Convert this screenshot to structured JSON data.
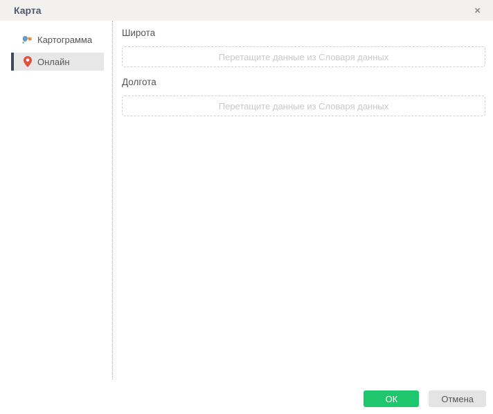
{
  "window": {
    "title": "Карта",
    "close_icon": "×"
  },
  "sidebar": {
    "items": [
      {
        "label": "Картограмма",
        "icon": "cartogram-map-icon",
        "selected": false
      },
      {
        "label": "Онлайн",
        "icon": "location-pin-icon",
        "selected": true
      }
    ]
  },
  "form": {
    "fields": [
      {
        "label": "Широта",
        "dropzone_placeholder": "Перетащите данные из Словаря данных"
      },
      {
        "label": "Долгота",
        "dropzone_placeholder": "Перетащите данные из Словаря данных"
      }
    ]
  },
  "footer": {
    "buttons": [
      {
        "label": "ОК",
        "style": "primary"
      },
      {
        "label": "Отмена",
        "style": "secondary"
      }
    ]
  },
  "colors": {
    "primary_green": "#1ec66d",
    "pin_red": "#e0513d",
    "selected_indicator": "#3e4a5a",
    "selected_bg": "#e7e7e7",
    "header_bg": "#f2f1f0",
    "placeholder_text": "#c9c9c9"
  }
}
